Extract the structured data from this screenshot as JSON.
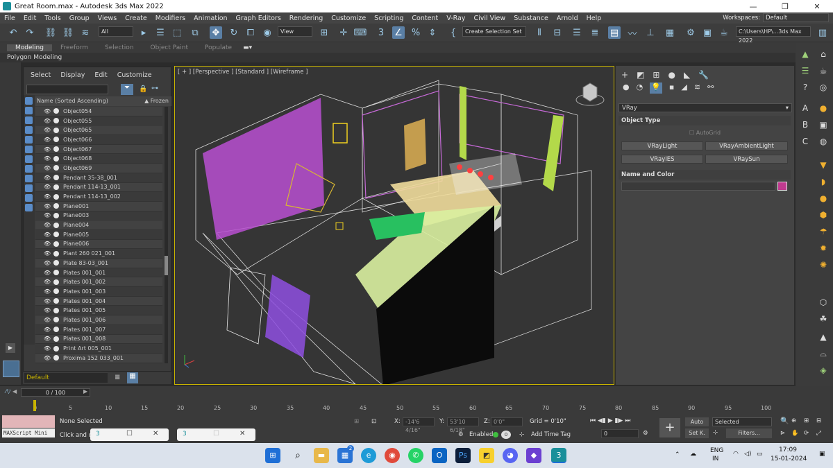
{
  "window": {
    "title": "Great Room.max - Autodesk 3ds Max 2022",
    "minimize": "—",
    "maximize": "❐",
    "close": "✕"
  },
  "menu": [
    "File",
    "Edit",
    "Tools",
    "Group",
    "Views",
    "Create",
    "Modifiers",
    "Animation",
    "Graph Editors",
    "Rendering",
    "Customize",
    "Scripting",
    "Content",
    "V-Ray",
    "Civil View",
    "Substance",
    "Arnold",
    "Help"
  ],
  "workspace": {
    "label": "Workspaces:",
    "value": "Default"
  },
  "toolbar": {
    "filter": "All",
    "view": "View",
    "selection_set": "Create Selection Set",
    "path": "C:\\Users\\HP\\...3ds Max 2022"
  },
  "ribbon": {
    "tabs": [
      "Modeling",
      "Freeform",
      "Selection",
      "Object Paint",
      "Populate"
    ],
    "active": "Modeling",
    "sub": "Polygon Modeling"
  },
  "explorer": {
    "menu": [
      "Select",
      "Display",
      "Edit",
      "Customize"
    ],
    "column_name": "Name (Sorted Ascending)",
    "column_frozen": "▲ Frozen",
    "rows": [
      "Object054",
      "Object055",
      "Object065",
      "Object066",
      "Object067",
      "Object068",
      "Object069",
      "Pendant 35-38_001",
      "Pendant 114-13_001",
      "Pendant 114-13_002",
      "Plane001",
      "Plane003",
      "Plane004",
      "Plane005",
      "Plane006",
      "Plant 260 021_001",
      "Plate 83-03_001",
      "Plates 001_001",
      "Plates 001_002",
      "Plates 001_003",
      "Plates 001_004",
      "Plates 001_005",
      "Plates 001_006",
      "Plates 001_007",
      "Plates 001_008",
      "Print Art 005_001",
      "Proxima 152 033_001"
    ]
  },
  "layer": "Default",
  "viewport": {
    "label": "[ + ] [Perspective ] [Standard ] [Wireframe ]"
  },
  "command_panel": {
    "category": "VRay",
    "object_type": "Object Type",
    "autogrid": "AutoGrid",
    "buttons": [
      "VRayLight",
      "VRayAmbientLight",
      "VRayIES",
      "VRaySun"
    ],
    "name_color": "Name and Color",
    "swatch": "#c03a8f"
  },
  "timeline": {
    "frame": "0 / 100",
    "ticks": [
      "0",
      "5",
      "10",
      "15",
      "20",
      "25",
      "30",
      "35",
      "40",
      "45",
      "50",
      "55",
      "60",
      "65",
      "70",
      "75",
      "80",
      "85",
      "90",
      "95",
      "100"
    ]
  },
  "status": {
    "maxscript": "MAXScript Mini",
    "selection": "None Selected",
    "prompt": "Click and dr",
    "x": "-14'6 4/16\"",
    "y": "53'10 6/18\"",
    "z": "0'0\"",
    "grid": "Grid = 0'10\"",
    "enabled": "Enabled:",
    "add_time_tag": "Add Time Tag",
    "auto": "Auto",
    "selected": "Selected",
    "setk": "Set K.",
    "filters": "Filters...",
    "frame_field": "0"
  },
  "taskbar": {
    "lang1": "ENG",
    "lang2": "IN",
    "time": "17:09",
    "date": "15-01-2024",
    "badge": "2"
  },
  "colors": {
    "accent": "#5a7fa5",
    "viewport_border": "#c9b400",
    "layer_text": "#c9b400"
  }
}
